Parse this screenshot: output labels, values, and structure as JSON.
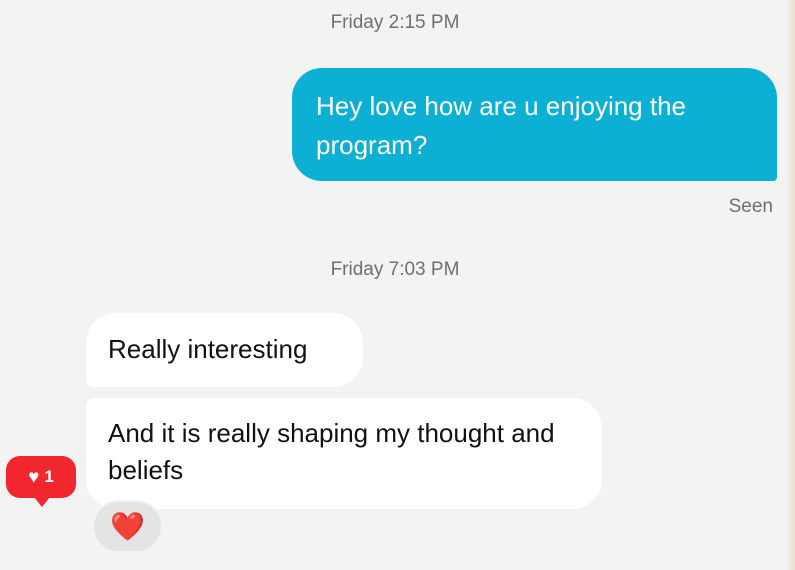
{
  "conversation": {
    "timestamps": [
      "Friday 2:15 PM",
      "Friday 7:03 PM"
    ],
    "outgoing": {
      "text": "Hey love how are u enjoying the program?",
      "status": "Seen",
      "color": "#0cb0d4"
    },
    "incoming": [
      {
        "text": "Really interesting"
      },
      {
        "text": "And it is really shaping my thought and beliefs"
      }
    ],
    "reaction": {
      "emoji": "❤️",
      "icon": "red-heart-icon"
    },
    "like_notification": {
      "icon": "heart-icon",
      "count": "1",
      "color": "#f1262f"
    }
  }
}
